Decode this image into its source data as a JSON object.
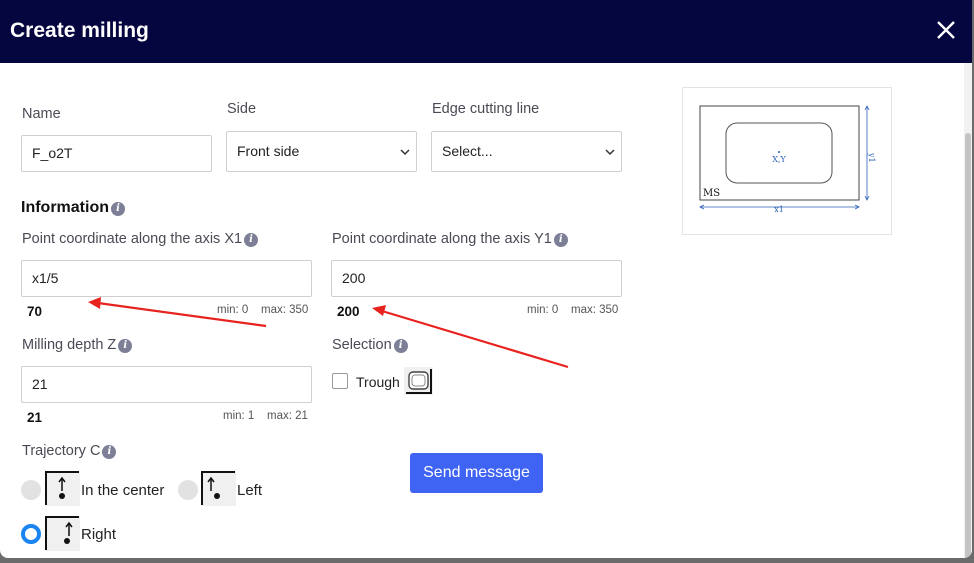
{
  "header": {
    "title": "Create milling"
  },
  "name_field": {
    "label": "Name",
    "value": "F_o2T"
  },
  "side_field": {
    "label": "Side",
    "value": "Front side"
  },
  "edge_field": {
    "label": "Edge cutting line",
    "value": "Select..."
  },
  "information": {
    "title": "Information"
  },
  "x1": {
    "label": "Point coordinate along the axis X1",
    "value": "x1/5",
    "computed": "70",
    "min": "min: 0",
    "max": "max: 350"
  },
  "y1": {
    "label": "Point coordinate along the axis Y1",
    "value": "200",
    "computed": "200",
    "min": "min: 0",
    "max": "max: 350"
  },
  "depth": {
    "label": "Milling depth Z",
    "value": "21",
    "computed": "21",
    "min": "min: 1",
    "max": "max: 21"
  },
  "selection": {
    "label": "Selection",
    "option": "Trough",
    "checked": false
  },
  "trajectory": {
    "label": "Trajectory C",
    "options": [
      {
        "label": "In the center",
        "selected": false
      },
      {
        "label": "Left",
        "selected": false
      },
      {
        "label": "Right",
        "selected": true
      }
    ]
  },
  "send_button": {
    "label": "Send message"
  },
  "preview": {
    "ms_label": "MS",
    "xy_label": "X,Y",
    "x_label": "x1",
    "y_label": "y1"
  },
  "info_icon_glyph": "i",
  "colors": {
    "header": "#050540",
    "accent": "#3f63f2",
    "radio_selected": "#1a84f0",
    "annotation_arrow": "#e8231f"
  }
}
